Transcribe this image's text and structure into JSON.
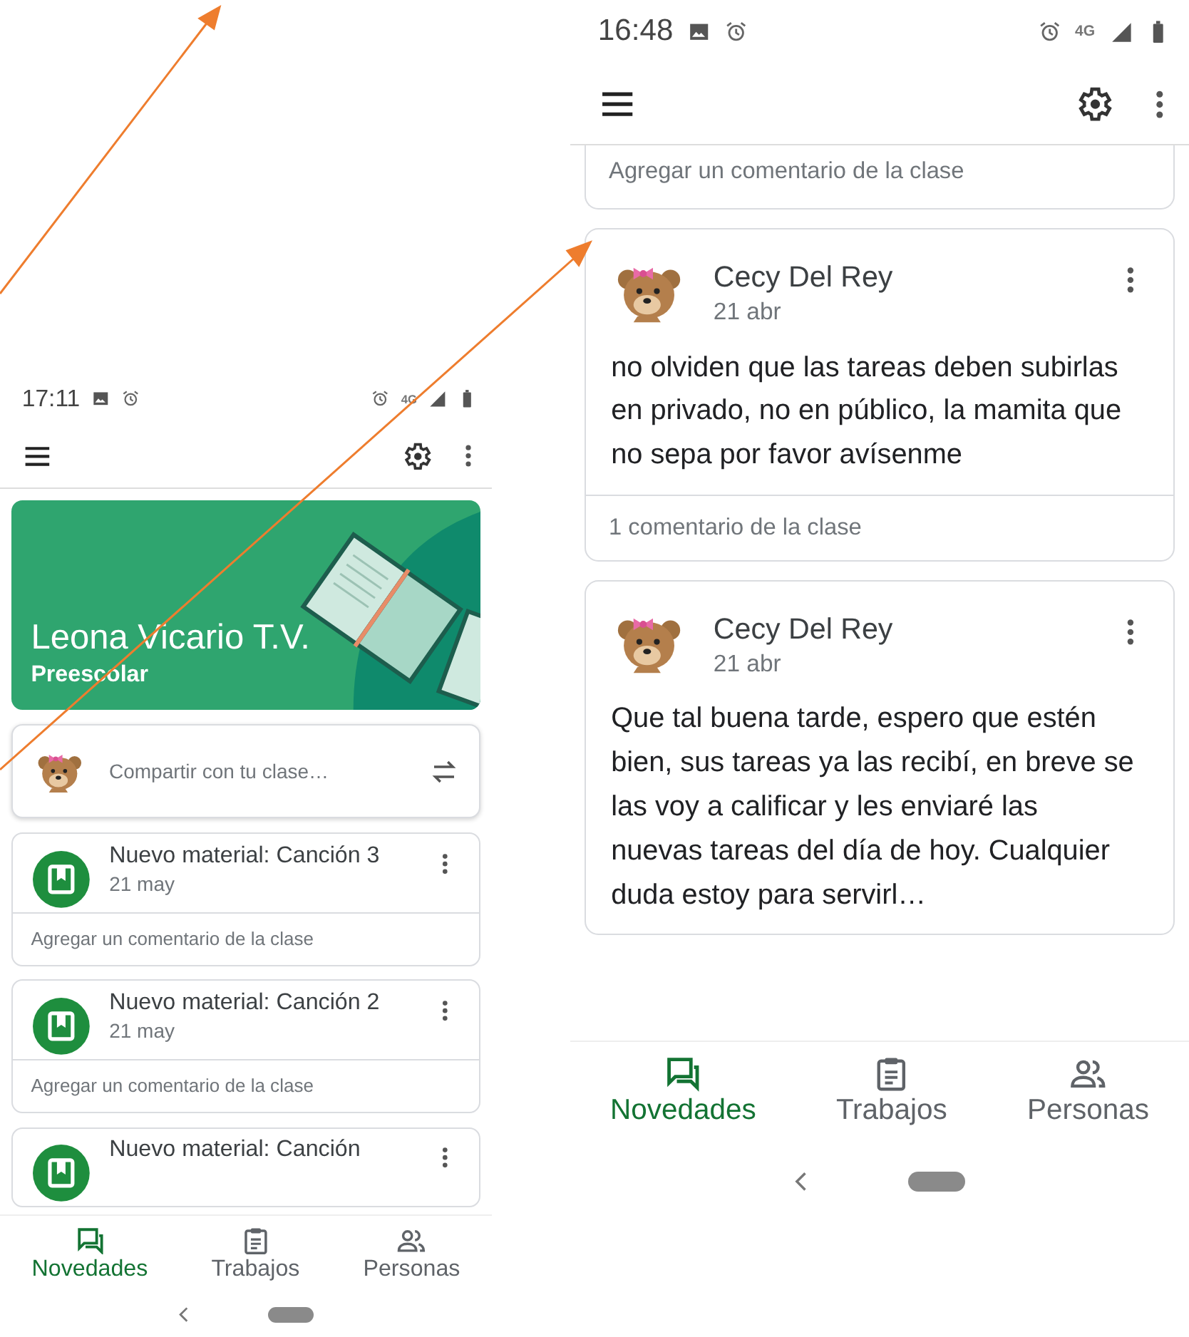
{
  "screens": [
    {
      "status_bar": {
        "time": "17:11",
        "network": "4G"
      },
      "banner": {
        "title": "Leona Vicario T.V.",
        "subtitle": "Preescolar"
      },
      "share": {
        "placeholder": "Compartir con tu clase…"
      },
      "posts": [
        {
          "kind": "material",
          "title": "Nuevo material: Canción 3",
          "date": "21 may",
          "footer": "Agregar un comentario de la clase"
        },
        {
          "kind": "material",
          "title": "Nuevo material: Canción 2",
          "date": "21 may",
          "footer": "Agregar un comentario de la clase"
        },
        {
          "kind": "material",
          "title": "Nuevo material: Canción"
        }
      ],
      "nav": [
        {
          "kind": "stream",
          "label": "Novedades",
          "selected": true
        },
        {
          "kind": "classwork",
          "label": "Trabajos",
          "selected": false
        },
        {
          "kind": "people",
          "label": "Personas",
          "selected": false
        }
      ]
    },
    {
      "status_bar": {
        "time": "16:48",
        "network": "4G"
      },
      "posts": [
        {
          "kind": "comment_stub",
          "footer": "Agregar un comentario de la clase"
        },
        {
          "kind": "announcement",
          "author": "Cecy Del Rey",
          "date": "21 abr",
          "body": "no olviden que las tareas deben subirlas en privado, no en público, la mamita que no sepa por favor avísenme",
          "footer": "1 comentario de la clase"
        },
        {
          "kind": "announcement",
          "author": "Cecy Del Rey",
          "date": "21 abr",
          "body": "Que tal buena tarde, espero que estén bien, sus tareas ya las recibí, en breve se las voy a calificar y les enviaré las nuevas tareas del día de hoy. Cualquier duda estoy para servirl…"
        }
      ],
      "nav": [
        {
          "kind": "stream",
          "label": "Novedades",
          "selected": true
        },
        {
          "kind": "classwork",
          "label": "Trabajos",
          "selected": false
        },
        {
          "kind": "people",
          "label": "Personas",
          "selected": false
        }
      ]
    }
  ]
}
